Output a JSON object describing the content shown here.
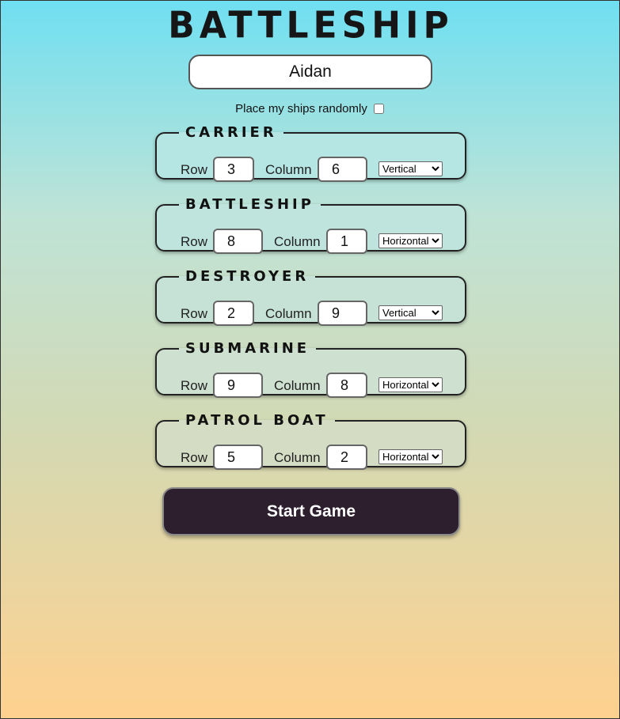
{
  "title": "BATTLESHIP",
  "player_name": "Aidan",
  "random_placement": {
    "label": "Place my ships randomly",
    "checked": false
  },
  "labels": {
    "row": "Row",
    "column": "Column"
  },
  "orientation_options": [
    "Vertical",
    "Horizontal"
  ],
  "ships": [
    {
      "name": "CARRIER",
      "row": "3",
      "column": "6",
      "orientation": "Vertical"
    },
    {
      "name": "BATTLESHIP",
      "row": "8",
      "column": "1",
      "orientation": "Horizontal"
    },
    {
      "name": "DESTROYER",
      "row": "2",
      "column": "9",
      "orientation": "Vertical"
    },
    {
      "name": "SUBMARINE",
      "row": "9",
      "column": "8",
      "orientation": "Horizontal"
    },
    {
      "name": "PATROL BOAT",
      "row": "5",
      "column": "2",
      "orientation": "Horizontal"
    }
  ],
  "start_button": "Start Game"
}
